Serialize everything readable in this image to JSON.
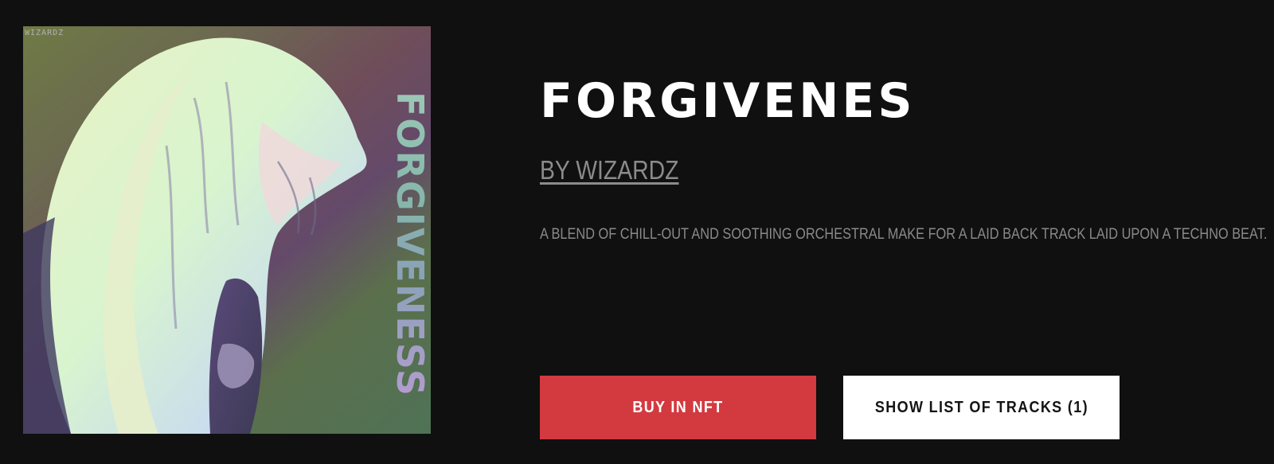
{
  "album": {
    "title": "FORGIVENES",
    "artist_label": "BY WIZARDZ",
    "description": "A BLEND OF CHILL-OUT AND SOOTHING ORCHESTRAL MAKE FOR A LAID BACK TRACK LAID UPON A TECHNO BEAT."
  },
  "cover": {
    "corner_tag": "WIZARDZ",
    "vertical_text": "FORGIVENESS",
    "accent_colors": [
      "#6f7a45",
      "#6f4d5a",
      "#4f7256",
      "#9bc8b6",
      "#b39cd0"
    ]
  },
  "actions": {
    "buy_label": "BUY IN NFT",
    "tracks_label": "SHOW LIST OF TRACKS (1)",
    "buy_color": "#d23a40",
    "tracks_color": "#ffffff"
  }
}
